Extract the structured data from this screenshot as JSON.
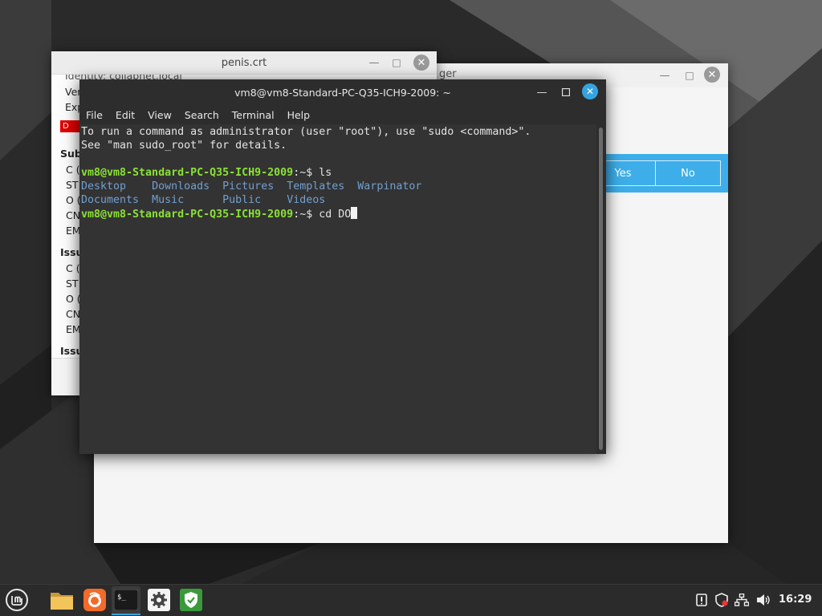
{
  "back_window": {
    "title_fragment": "ger",
    "message_bar": {
      "yes_label": "Yes",
      "no_label": "No"
    }
  },
  "cert_window": {
    "title": "penis.crt",
    "lines": [
      "Identity: collabnet.local",
      "Ver",
      "Exp",
      "Subj",
      "C (",
      "ST",
      "O (",
      "CN",
      "EM",
      "Issu",
      "C (",
      "ST",
      "O (",
      "CN",
      "EM",
      "Issu"
    ],
    "red_badge": "D"
  },
  "terminal": {
    "title": "vm8@vm8-Standard-PC-Q35-ICH9-2009: ~",
    "menu": [
      "File",
      "Edit",
      "View",
      "Search",
      "Terminal",
      "Help"
    ],
    "intro_line1": "To run a command as administrator (user \"root\"), use \"sudo <command>\".",
    "intro_line2": "See \"man sudo_root\" for details.",
    "prompt_user": "vm8@vm8-Standard-PC-Q35-ICH9-2009",
    "prompt_path": ":~$ ",
    "command1": "ls",
    "ls_row1": [
      "Desktop",
      "Downloads",
      "Pictures",
      "Templates",
      "Warpinator"
    ],
    "ls_row2": [
      "Documents",
      "Music",
      "Public",
      "Videos"
    ],
    "command2": "cd DO"
  },
  "taskbar": {
    "apps": [
      "menu-icon",
      "files-icon",
      "firefox-icon",
      "terminal-icon",
      "settings-icon",
      "update-manager-icon"
    ],
    "tray": [
      "notification-icon",
      "shield-icon",
      "network-icon",
      "volume-icon"
    ],
    "clock": "16:29"
  },
  "colors": {
    "accent": "#35a4de",
    "prompt_green": "#8ae234",
    "dir_blue": "#729fcf",
    "message_bar": "#3daee9"
  }
}
